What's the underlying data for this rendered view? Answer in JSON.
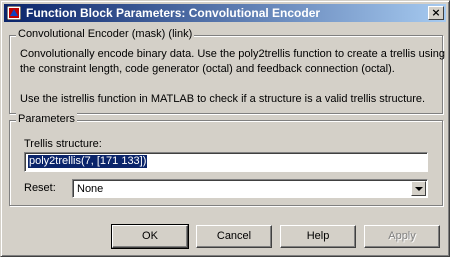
{
  "window": {
    "title": "Function Block Parameters: Convolutional Encoder",
    "close_glyph": "×"
  },
  "description_group": {
    "legend": "Convolutional Encoder (mask) (link)",
    "lines": [
      "Convolutionally encode binary data. Use the poly2trellis function to create a trellis using",
      "the constraint length, code generator (octal) and feedback connection (octal).",
      "",
      "Use the istrellis function in MATLAB to check if a structure is a valid trellis structure."
    ]
  },
  "parameters_group": {
    "legend": "Parameters",
    "trellis_label": "Trellis structure:",
    "trellis_value": "poly2trellis(7, [171 133])",
    "reset_label": "Reset:",
    "reset_value": "None"
  },
  "buttons": {
    "ok": "OK",
    "cancel": "Cancel",
    "help": "Help",
    "apply": "Apply"
  }
}
